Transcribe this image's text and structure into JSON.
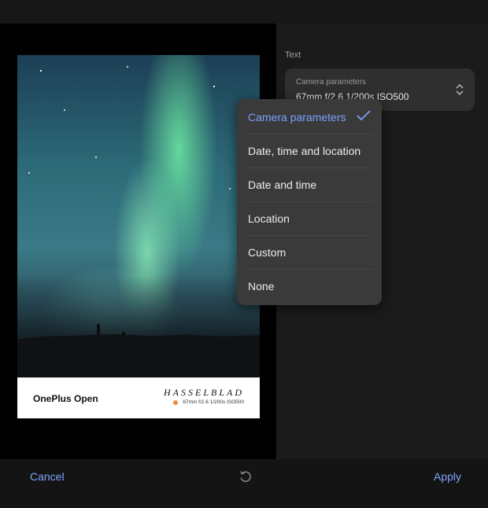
{
  "panel": {
    "section_label": "Text",
    "select": {
      "caption": "Camera parameters",
      "value": "67mm  f/2.6  1/200s  ISO500"
    }
  },
  "dropdown": {
    "items": [
      {
        "label": "Camera parameters",
        "selected": true
      },
      {
        "label": "Date, time and location",
        "selected": false
      },
      {
        "label": "Date and time",
        "selected": false
      },
      {
        "label": "Location",
        "selected": false
      },
      {
        "label": "Custom",
        "selected": false
      },
      {
        "label": "None",
        "selected": false
      }
    ]
  },
  "watermark": {
    "device": "OnePlus Open",
    "brand": "HASSELBLAD",
    "params": "67mm  f/2.6  1/200s  ISO500",
    "dot_color": "#f08a3a"
  },
  "bottom": {
    "cancel_label": "Cancel",
    "apply_label": "Apply"
  },
  "colors": {
    "accent": "#7ea4ff",
    "selected": "#7aa0ff"
  },
  "icons": {
    "reset": "reset-icon",
    "chevrons": "chevron-up-down-icon",
    "check": "check-icon"
  }
}
